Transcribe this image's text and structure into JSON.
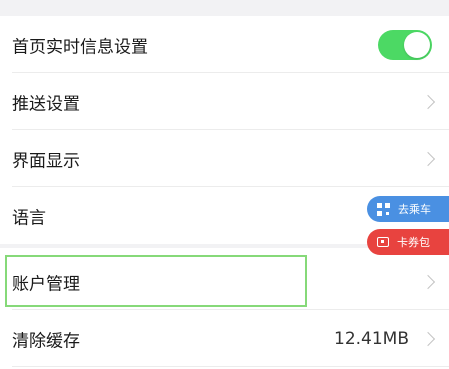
{
  "settings": {
    "realtime_info": {
      "label": "首页实时信息设置",
      "toggle_on": true
    },
    "push": {
      "label": "推送设置"
    },
    "display": {
      "label": "界面显示"
    },
    "language": {
      "label": "语言"
    },
    "account": {
      "label": "账户管理"
    },
    "cache": {
      "label": "清除缓存",
      "value": "12.41MB"
    }
  },
  "floating": {
    "ride": {
      "label": "去乘车",
      "icon": "qr-code-icon"
    },
    "card": {
      "label": "卡券包",
      "icon": "ticket-icon"
    }
  },
  "colors": {
    "toggle_on": "#4cd964",
    "ride_pill": "#4a90e2",
    "card_pill": "#e8433f",
    "highlight": "#86d979"
  }
}
